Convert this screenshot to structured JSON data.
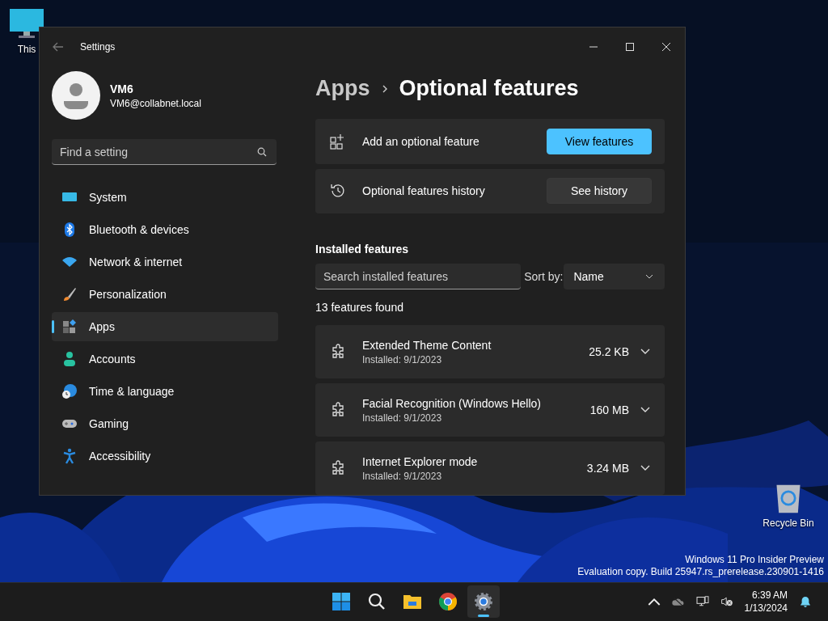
{
  "desktop_icons": [
    {
      "kind": "pc",
      "label": "This"
    },
    {
      "kind": "bin",
      "label": "Recycle Bin"
    }
  ],
  "window": {
    "title": "Settings",
    "user": {
      "name": "VM6",
      "email": "VM6@collabnet.local"
    },
    "search": {
      "placeholder": "Find a setting"
    },
    "nav": [
      {
        "kind": "system",
        "label": "System",
        "selected": false
      },
      {
        "kind": "bluetooth",
        "label": "Bluetooth & devices",
        "selected": false
      },
      {
        "kind": "network",
        "label": "Network & internet",
        "selected": false
      },
      {
        "kind": "brush",
        "label": "Personalization",
        "selected": false
      },
      {
        "kind": "apps",
        "label": "Apps",
        "selected": true
      },
      {
        "kind": "accounts",
        "label": "Accounts",
        "selected": false
      },
      {
        "kind": "time",
        "label": "Time & language",
        "selected": false
      },
      {
        "kind": "gaming",
        "label": "Gaming",
        "selected": false
      },
      {
        "kind": "accessibility",
        "label": "Accessibility",
        "selected": false
      }
    ],
    "breadcrumb": {
      "parent": "Apps",
      "current": "Optional features"
    },
    "actions": [
      {
        "kind": "add",
        "label": "Add an optional feature",
        "button": "View features",
        "primary": true
      },
      {
        "kind": "history",
        "label": "Optional features history",
        "button": "See history",
        "primary": false
      }
    ],
    "installed": {
      "heading": "Installed features",
      "search_placeholder": "Search installed features",
      "sort_label": "Sort by:",
      "sort_value": "Name",
      "count": "13 features found",
      "features": [
        {
          "name": "Extended Theme Content",
          "installed": "Installed: 9/1/2023",
          "size": "25.2 KB"
        },
        {
          "name": "Facial Recognition (Windows Hello)",
          "installed": "Installed: 9/1/2023",
          "size": "160 MB"
        },
        {
          "name": "Internet Explorer mode",
          "installed": "Installed: 9/1/2023",
          "size": "3.24 MB"
        }
      ]
    }
  },
  "os_notice": [
    "Windows 11 Pro Insider Preview",
    "Evaluation copy. Build 25947.rs_prerelease.230901-1416"
  ],
  "taskbar": {
    "apps": [
      {
        "kind": "start",
        "selected": false
      },
      {
        "kind": "search",
        "selected": false
      },
      {
        "kind": "explorer",
        "selected": false
      },
      {
        "kind": "chrome",
        "selected": false
      },
      {
        "kind": "settings",
        "selected": true
      }
    ],
    "time": "6:39 AM",
    "date": "1/13/2024"
  }
}
